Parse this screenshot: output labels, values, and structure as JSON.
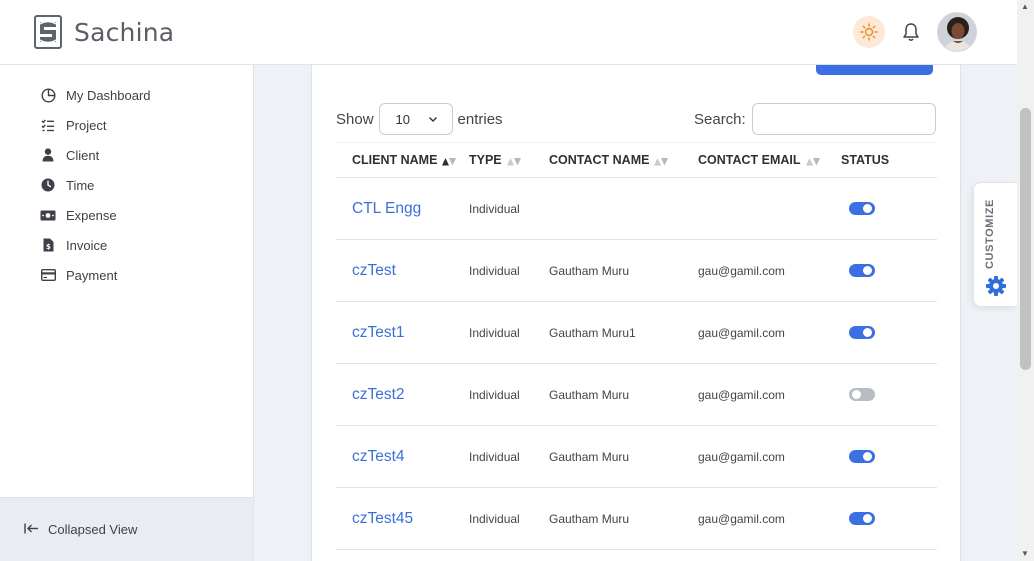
{
  "app": {
    "brand": "Sachina"
  },
  "sidebar": {
    "items": [
      {
        "label": "My Dashboard",
        "icon": "pie-chart-icon"
      },
      {
        "label": "Project",
        "icon": "checklist-icon"
      },
      {
        "label": "Client",
        "icon": "user-icon"
      },
      {
        "label": "Time",
        "icon": "clock-icon"
      },
      {
        "label": "Expense",
        "icon": "money-icon"
      },
      {
        "label": "Invoice",
        "icon": "invoice-icon"
      },
      {
        "label": "Payment",
        "icon": "card-icon"
      }
    ],
    "collapse_label": "Collapsed View"
  },
  "table_controls": {
    "show_label": "Show",
    "entries_value": "10",
    "entries_label": "entries",
    "search_label": "Search:",
    "search_value": ""
  },
  "table": {
    "columns": [
      "CLIENT NAME",
      "TYPE",
      "CONTACT NAME",
      "CONTACT EMAIL",
      "STATUS"
    ],
    "rows": [
      {
        "name": "CTL Engg",
        "type": "Individual",
        "contact": "",
        "email": "",
        "active": true
      },
      {
        "name": "czTest",
        "type": "Individual",
        "contact": "Gautham Muru",
        "email": "gau@gamil.com",
        "active": true
      },
      {
        "name": "czTest1",
        "type": "Individual",
        "contact": "Gautham Muru1",
        "email": "gau@gamil.com",
        "active": true
      },
      {
        "name": "czTest2",
        "type": "Individual",
        "contact": "Gautham Muru",
        "email": "gau@gamil.com",
        "active": false
      },
      {
        "name": "czTest4",
        "type": "Individual",
        "contact": "Gautham Muru",
        "email": "gau@gamil.com",
        "active": true
      },
      {
        "name": "czTest45",
        "type": "Individual",
        "contact": "Gautham Muru",
        "email": "gau@gamil.com",
        "active": true
      }
    ]
  },
  "customize": {
    "label": "CUSTOMIZE"
  },
  "colors": {
    "accent": "#3c6ee4",
    "link": "#3b6fd9",
    "theme_bg": "#fde9d6",
    "theme_icon": "#e8892b"
  }
}
